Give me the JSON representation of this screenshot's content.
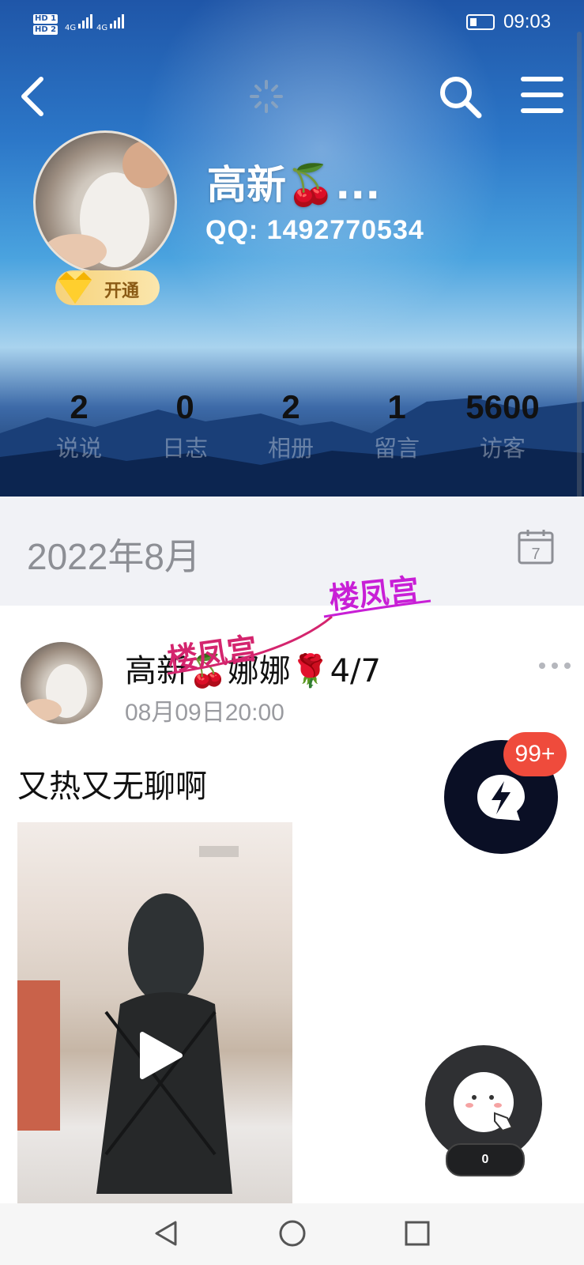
{
  "status_bar": {
    "sim1": "HD 1",
    "sim2": "HD 2",
    "net1": "4G",
    "net2": "4G",
    "time": "09:03"
  },
  "profile": {
    "username": "高新🍒...",
    "qq_label": "QQ:",
    "qq_number": "1492770534",
    "vip_label": "开通"
  },
  "stats": [
    {
      "value": "2",
      "label": "说说"
    },
    {
      "value": "0",
      "label": "日志"
    },
    {
      "value": "2",
      "label": "相册"
    },
    {
      "value": "1",
      "label": "留言"
    },
    {
      "value": "5600",
      "label": "访客"
    }
  ],
  "month": {
    "label": "2022年8月",
    "calendar_day": "7"
  },
  "post": {
    "author": "高新🍒娜娜🌹4/7",
    "timestamp": "08月09日20:00",
    "text": "又热又无聊啊"
  },
  "watermarks": [
    "楼凤宫",
    "楼凤宫"
  ],
  "floating": {
    "badge": "99+",
    "face_count": "0"
  },
  "colors": {
    "badge_red": "#ef4b3c",
    "fab_dark": "#0a0f25",
    "watermark_magenta": "#c81fd6"
  },
  "icons": {
    "back": "back-arrow-icon",
    "search": "search-icon",
    "menu": "menu-icon",
    "calendar": "calendar-icon",
    "more": "more-icon",
    "play": "play-icon",
    "bolt": "lightning-chat-icon",
    "face": "smiley-face-icon"
  }
}
